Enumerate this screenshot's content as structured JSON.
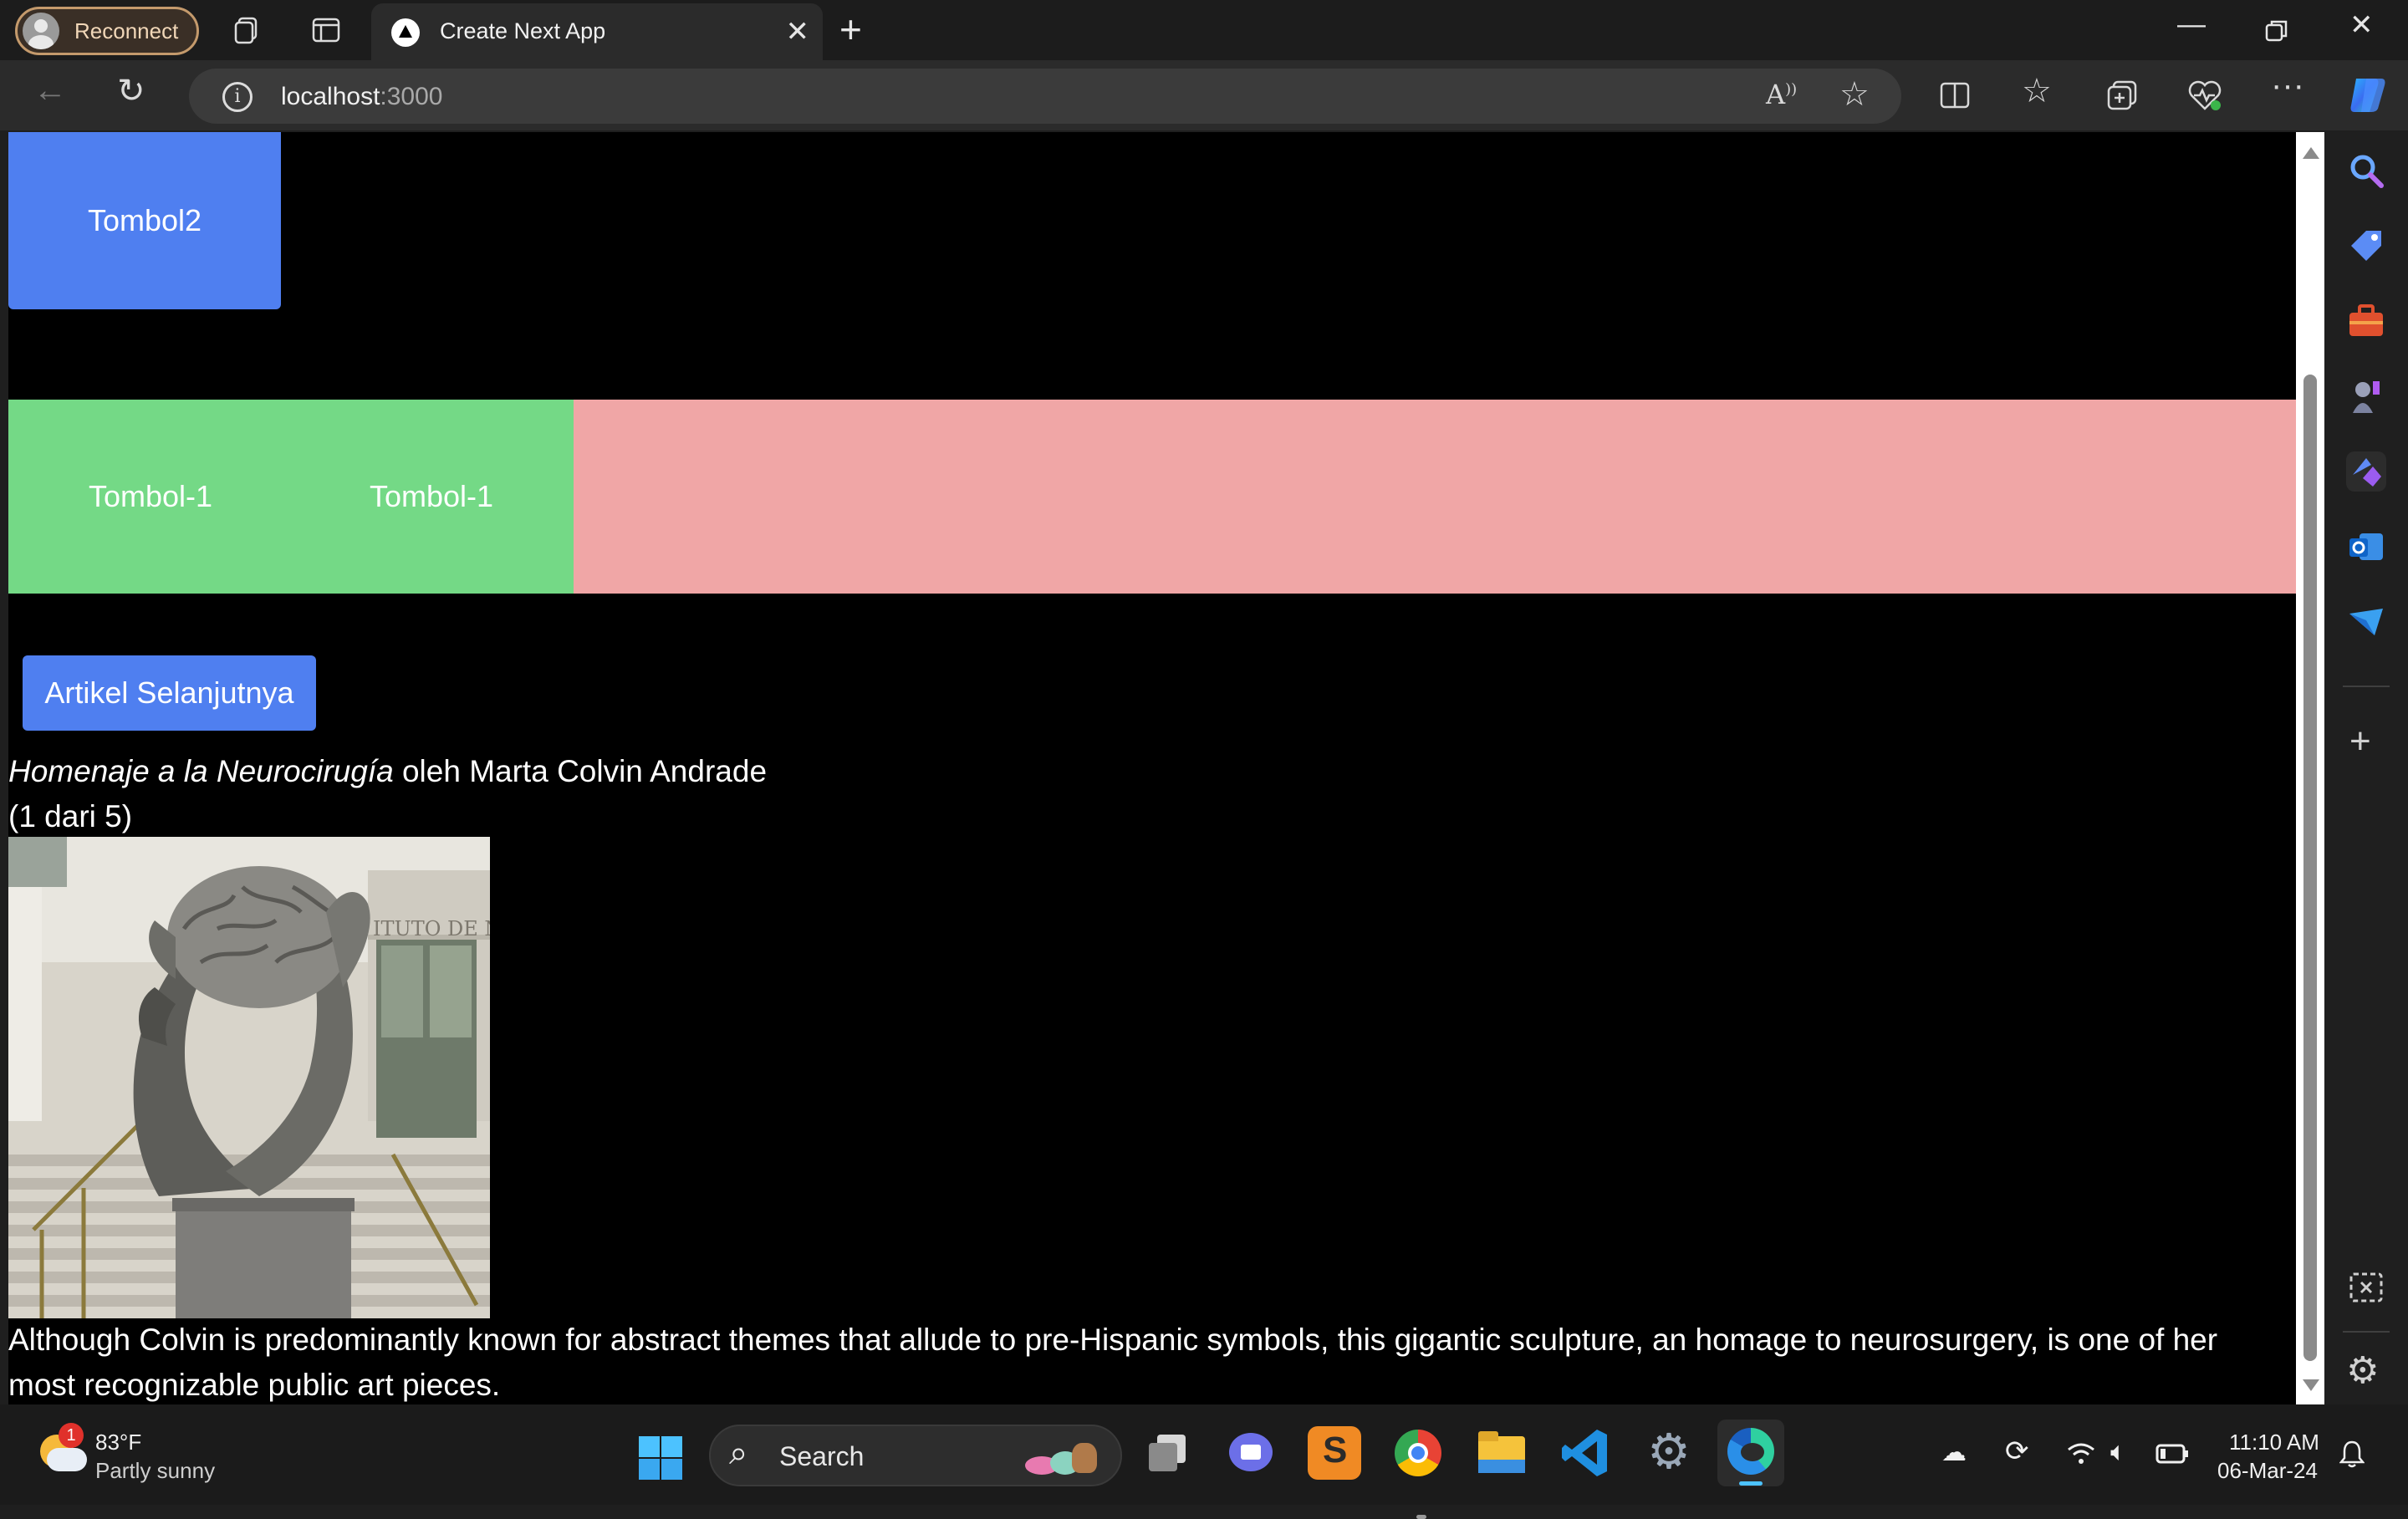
{
  "browser": {
    "profile_label": "Reconnect",
    "tab_title": "Create Next App",
    "url_host": "localhost",
    "url_port": ":3000"
  },
  "page": {
    "button_top": "Tombol2",
    "row_buttons": [
      "Tombol-1",
      "Tombol-1"
    ],
    "next_article_button": "Artikel Selanjutnya",
    "artwork_title": "Homenaje a la Neurocirugía",
    "artwork_by": " oleh Marta Colvin Andrade",
    "counter": "(1 dari 5)",
    "image_alt": "Homenaje a la Neurocirugía",
    "image_sign_text": "ITUTO DE NE",
    "description": "Although Colvin is predominantly known for abstract themes that allude to pre-Hispanic symbols, this gigantic sculpture, an homage to neurosurgery, is one of her most recognizable public art pieces."
  },
  "taskbar": {
    "weather_temp": "83°F",
    "weather_desc": "Partly sunny",
    "weather_badge": "1",
    "search_label": "Search",
    "time": "11:10 AM",
    "date": "06-Mar-24"
  },
  "colors": {
    "accent_blue": "#4f7ff0",
    "green": "#74d986",
    "pink": "#f0a6a6"
  }
}
